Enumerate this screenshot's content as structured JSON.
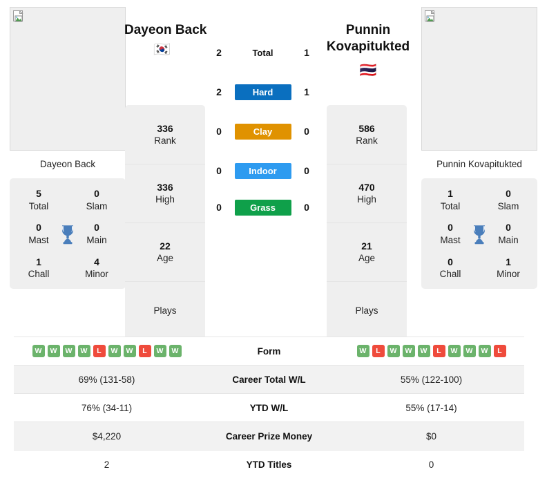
{
  "players": {
    "left": {
      "name": "Dayeon Back",
      "flag": "🇰🇷",
      "photo_caption": "Dayeon Back",
      "titles": [
        {
          "num": "5",
          "label": "Total"
        },
        {
          "num": "0",
          "label": "Slam"
        },
        {
          "num": "0",
          "label": "Mast"
        },
        {
          "num": "0",
          "label": "Main"
        },
        {
          "num": "1",
          "label": "Chall"
        },
        {
          "num": "4",
          "label": "Minor"
        }
      ],
      "rank_cells": [
        {
          "num": "336",
          "label": "Rank"
        },
        {
          "num": "336",
          "label": "High"
        },
        {
          "num": "22",
          "label": "Age"
        },
        {
          "num": "",
          "label": "Plays"
        }
      ]
    },
    "right": {
      "name": "Punnin Kovapitukted",
      "flag": "🇹🇭",
      "photo_caption": "Punnin Kovapitukted",
      "titles": [
        {
          "num": "1",
          "label": "Total"
        },
        {
          "num": "0",
          "label": "Slam"
        },
        {
          "num": "0",
          "label": "Mast"
        },
        {
          "num": "0",
          "label": "Main"
        },
        {
          "num": "0",
          "label": "Chall"
        },
        {
          "num": "1",
          "label": "Minor"
        }
      ],
      "rank_cells": [
        {
          "num": "586",
          "label": "Rank"
        },
        {
          "num": "470",
          "label": "High"
        },
        {
          "num": "21",
          "label": "Age"
        },
        {
          "num": "",
          "label": "Plays"
        }
      ]
    }
  },
  "h2h": [
    {
      "left": "2",
      "label": "Total",
      "right": "1",
      "style": "plain",
      "color": ""
    },
    {
      "left": "2",
      "label": "Hard",
      "right": "1",
      "style": "badge",
      "color": "#0a6fbf"
    },
    {
      "left": "0",
      "label": "Clay",
      "right": "0",
      "style": "badge",
      "color": "#e09200"
    },
    {
      "left": "0",
      "label": "Indoor",
      "right": "0",
      "style": "badge",
      "color": "#2e9bf0"
    },
    {
      "left": "0",
      "label": "Grass",
      "right": "0",
      "style": "badge",
      "color": "#0fa04a"
    }
  ],
  "form": {
    "label": "Form",
    "left": [
      "W",
      "W",
      "W",
      "W",
      "L",
      "W",
      "W",
      "L",
      "W",
      "W"
    ],
    "right": [
      "W",
      "L",
      "W",
      "W",
      "W",
      "L",
      "W",
      "W",
      "W",
      "L"
    ],
    "win_color": "#6bb36b",
    "loss_color": "#ef4b3c"
  },
  "stats_rows": [
    {
      "left": "69% (131-58)",
      "label": "Career Total W/L",
      "right": "55% (122-100)"
    },
    {
      "left": "76% (34-11)",
      "label": "YTD W/L",
      "right": "55% (17-14)"
    },
    {
      "left": "$4,220",
      "label": "Career Prize Money",
      "right": "$0"
    },
    {
      "left": "2",
      "label": "YTD Titles",
      "right": "0"
    }
  ]
}
